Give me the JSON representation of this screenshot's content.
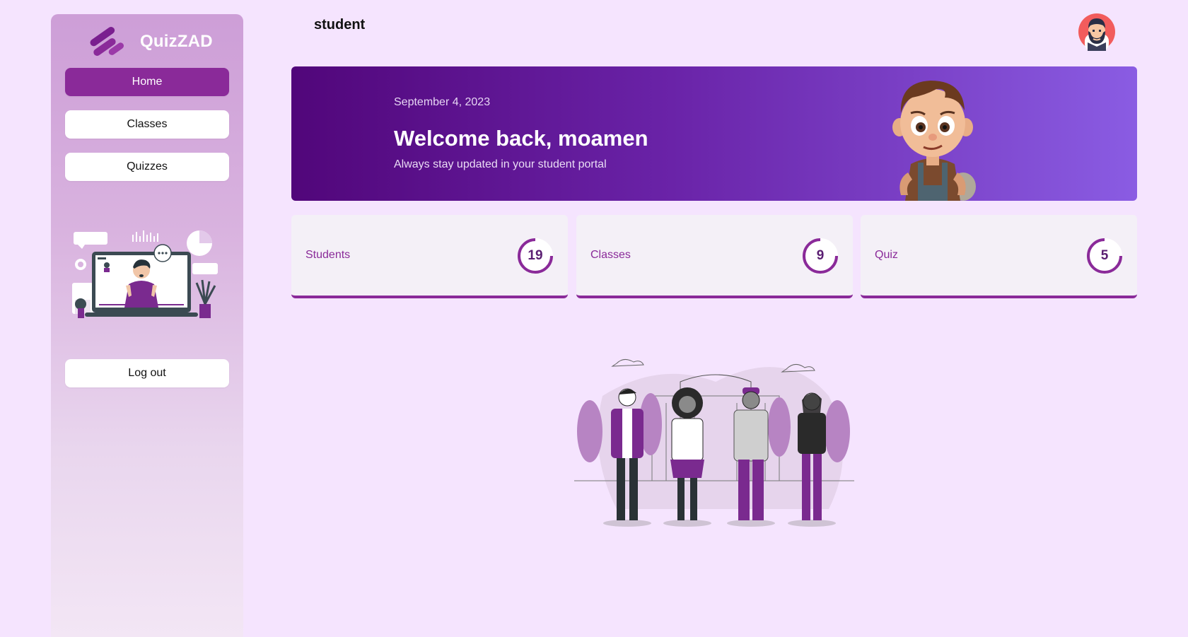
{
  "app": {
    "name": "QuizZAD"
  },
  "header": {
    "title": "student"
  },
  "sidebar": {
    "items": [
      {
        "label": "Home",
        "active": true
      },
      {
        "label": "Classes",
        "active": false
      },
      {
        "label": "Quizzes",
        "active": false
      }
    ],
    "logout_label": "Log out"
  },
  "banner": {
    "date": "September 4, 2023",
    "welcome": "Welcome back, moamen",
    "subtitle": "Always stay updated in your student portal"
  },
  "stats": [
    {
      "label": "Students",
      "value": "19"
    },
    {
      "label": "Classes",
      "value": "9"
    },
    {
      "label": "Quiz",
      "value": "5"
    }
  ],
  "colors": {
    "accent": "#8a2a99",
    "background": "#f5e4fe",
    "banner_start": "#51067a",
    "banner_end": "#8a5ce3"
  },
  "icons": {
    "logo": "quizzad-logo-icon",
    "avatar": "bearded-man-avatar-icon"
  }
}
